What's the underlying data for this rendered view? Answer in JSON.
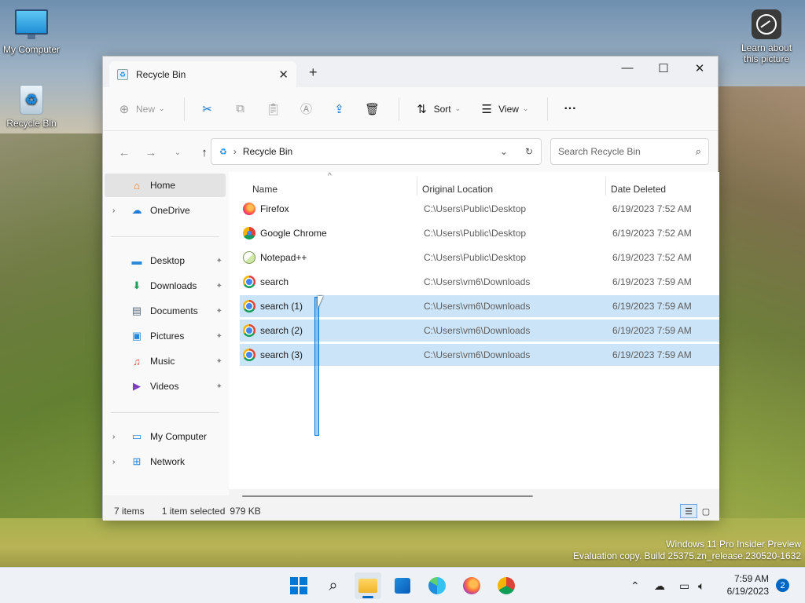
{
  "desktop": {
    "icons": [
      {
        "label": "My Computer"
      },
      {
        "label": "Recycle Bin"
      }
    ],
    "learn_label_line1": "Learn about",
    "learn_label_line2": "this picture",
    "watermark_line1": "Windows 11 Pro Insider Preview",
    "watermark_line2": "Evaluation copy. Build 25375.zn_release.230520-1632"
  },
  "window": {
    "tab_title": "Recycle Bin",
    "controls": {
      "minimize": "—",
      "maximize": "☐",
      "close": "✕"
    },
    "toolbar": {
      "new_label": "New",
      "sort_label": "Sort",
      "view_label": "View",
      "more_label": "···"
    },
    "address": {
      "crumb": "Recycle Bin"
    },
    "search": {
      "placeholder": "Search Recycle Bin"
    }
  },
  "sidebar": {
    "items": [
      {
        "label": "Home"
      },
      {
        "label": "OneDrive"
      },
      {
        "label": "Desktop"
      },
      {
        "label": "Downloads"
      },
      {
        "label": "Documents"
      },
      {
        "label": "Pictures"
      },
      {
        "label": "Music"
      },
      {
        "label": "Videos"
      },
      {
        "label": "My Computer"
      },
      {
        "label": "Network"
      }
    ]
  },
  "list": {
    "headers": {
      "name": "Name",
      "location": "Original Location",
      "date": "Date Deleted"
    },
    "rows": [
      {
        "name": "Firefox",
        "location": "C:\\Users\\Public\\Desktop",
        "date": "6/19/2023 7:52 AM",
        "selected": false
      },
      {
        "name": "Google Chrome",
        "location": "C:\\Users\\Public\\Desktop",
        "date": "6/19/2023 7:52 AM",
        "selected": false
      },
      {
        "name": "Notepad++",
        "location": "C:\\Users\\Public\\Desktop",
        "date": "6/19/2023 7:52 AM",
        "selected": false
      },
      {
        "name": "search",
        "location": "C:\\Users\\vm6\\Downloads",
        "date": "6/19/2023 7:59 AM",
        "selected": false
      },
      {
        "name": "search (1)",
        "location": "C:\\Users\\vm6\\Downloads",
        "date": "6/19/2023 7:59 AM",
        "selected": true
      },
      {
        "name": "search (2)",
        "location": "C:\\Users\\vm6\\Downloads",
        "date": "6/19/2023 7:59 AM",
        "selected": true
      },
      {
        "name": "search (3)",
        "location": "C:\\Users\\vm6\\Downloads",
        "date": "6/19/2023 7:59 AM",
        "selected": true
      }
    ]
  },
  "status": {
    "items_count": "7 items",
    "selection": "1 item selected",
    "size": "979 KB"
  },
  "taskbar": {
    "time": "7:59 AM",
    "date": "6/19/2023",
    "notifications": "2"
  },
  "colors": {
    "selection": "#cce4f7",
    "accent": "#0067c0"
  }
}
